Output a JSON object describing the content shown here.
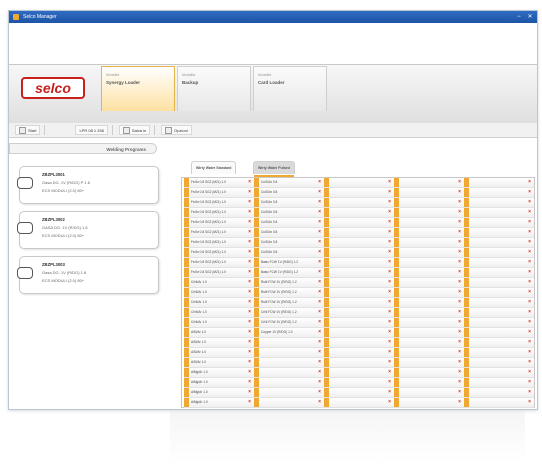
{
  "window": {
    "title": "Selco Manager"
  },
  "header": {
    "logo_text": "selco",
    "tabs": [
      {
        "small": "Modalità",
        "label": "Synergy Loader",
        "active": true
      },
      {
        "small": "Modalità",
        "label": "Backup",
        "active": false
      },
      {
        "small": "Modalità",
        "label": "Card Loader",
        "active": false
      }
    ]
  },
  "toolbar": {
    "items": [
      {
        "label": "Start"
      },
      {
        "label": "LPR 08 1 256"
      },
      {
        "label": "Salva in"
      },
      {
        "label": "Opzioni"
      }
    ]
  },
  "left_panel": {
    "title": "Welding Programs",
    "cards": [
      {
        "code": "ZBZPL3001",
        "line1": "Gasa DG. 1V (R/DG) P 1.6",
        "line2": "ECS  MODULI (2.0) 80+"
      },
      {
        "code": "ZBZPL3002",
        "line1": "GASA DG. 1V (R/DG) 1.6",
        "line2": "ECS  MODULI (2.0) 80+"
      },
      {
        "code": "ZBZPL3003",
        "line1": "Gasa DG. 1V (R/DG) 1.6",
        "line2": "ECS  MODULI (2.0) 80+"
      }
    ]
  },
  "right_panel": {
    "tabs": [
      {
        "label": "Wirty Water Standard",
        "active": false
      },
      {
        "label": "Wirty Water Pulsed",
        "active": true
      }
    ],
    "columns": [
      [
        "Fe/Ar 0.8 SG2 (M21) 1.0",
        "Fe/Ar 0.8 SG2 (M21) 1.0",
        "Fe/Ar 0.8 SG2 (M21) 1.0",
        "Fe/Ar 0.8 SG2 (M21) 1.0",
        "Fe/Ar 0.8 SG2 (M21) 1.0",
        "Fe/Ar 0.8 SG2 (M21) 1.0",
        "Fe/Ar 0.8 SG2 (M21) 1.0",
        "Fe/Ar 0.8 SG2 (M21) 1.0",
        "Fe/Ar 0.8 SG2 (M21) 1.0",
        "Fe/Ar 0.8 SG2 (M21) 1.0",
        "CrNi/Ar 1.0",
        "CrNi/Ar 1.0",
        "CrNi/Ar 1.0",
        "CrNi/Ar 1.0",
        "CrNi/Ar 1.0",
        "AlSi/Ar 1.0",
        "AlSi/Ar 1.0",
        "AlSi/Ar 1.0",
        "AlSi/Ar 1.0",
        "AlMg/Ar 1.0",
        "AlMg/Ar 1.0",
        "AlMg/Ar 1.0",
        "AlMg/Ar 1.0"
      ],
      [
        "CuSi/Ar 0.8",
        "CuSi/Ar 0.8",
        "CuSi/Ar 0.8",
        "CuSi/Ar 0.8",
        "CuSi/Ar 0.8",
        "CuSi/Ar 0.8",
        "CuSi/Ar 0.8",
        "CuSi/Ar 0.8",
        "Basic FCW 1V (R/DG) 1.2",
        "Basic FCW 1V (R/DG) 1.2",
        "Rutil FCW 1V (R/DG) 1.2",
        "Rutil FCW 1V (R/DG) 1.2",
        "Rutil FCW 1V (R/DG) 1.2",
        "CrNi FCW 1V (R/DG) 1.2",
        "CrNi FCW 1V (R/DG) 1.2",
        "Copper 1V (R/DG) 1.0",
        "",
        "",
        "",
        "",
        "",
        "",
        ""
      ],
      [
        "",
        "",
        "",
        "",
        "",
        "",
        "",
        "",
        "",
        "",
        "",
        "",
        "",
        "",
        "",
        "",
        "",
        "",
        "",
        "",
        "",
        "",
        ""
      ],
      [
        "",
        "",
        "",
        "",
        "",
        "",
        "",
        "",
        "",
        "",
        "",
        "",
        "",
        "",
        "",
        "",
        "",
        "",
        "",
        "",
        "",
        "",
        ""
      ],
      [
        "",
        "",
        "",
        "",
        "",
        "",
        "",
        "",
        "",
        "",
        "",
        "",
        "",
        "",
        "",
        "",
        "",
        "",
        "",
        "",
        "",
        "",
        ""
      ]
    ]
  },
  "icons": {
    "close": "close-icon",
    "minimize": "minimize-icon",
    "plug": "connector-icon",
    "remove": "remove-icon"
  },
  "colors": {
    "accent": "#f0a830",
    "brand": "#c8211d",
    "titlebar": "#1d54a5"
  }
}
